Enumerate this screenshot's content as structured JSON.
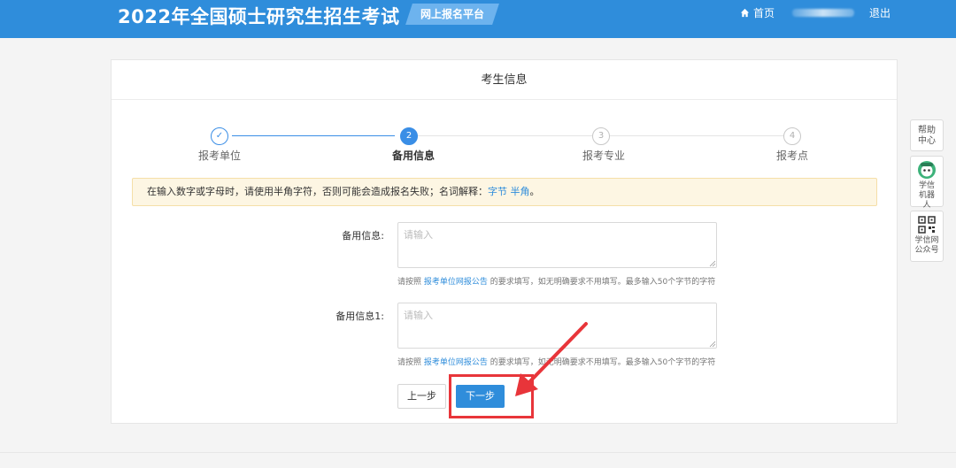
{
  "header": {
    "title": "2022年全国硕士研究生招生考试",
    "platform_badge": "网上报名平台",
    "home_label": "首页",
    "logout_label": "退出"
  },
  "card": {
    "title": "考生信息"
  },
  "steps": [
    {
      "number": "✓",
      "label": "报考单位",
      "state": "done"
    },
    {
      "number": "2",
      "label": "备用信息",
      "state": "active"
    },
    {
      "number": "3",
      "label": "报考专业",
      "state": "todo"
    },
    {
      "number": "4",
      "label": "报考点",
      "state": "todo"
    }
  ],
  "notice": {
    "text": "在输入数字或字母时，请使用半角字符，否则可能会造成报名失败；名词解释：",
    "link_byte": "字节",
    "link_halfwidth": "半角",
    "end": "。"
  },
  "form": {
    "field1": {
      "label": "备用信息:",
      "placeholder": "请输入",
      "value": "",
      "hint_prefix": "请按照",
      "hint_link": "报考单位网报公告",
      "hint_suffix": "的要求填写，如无明确要求不用填写。最多输入50个字节的字符"
    },
    "field2": {
      "label": "备用信息1:",
      "placeholder": "请输入",
      "value": "",
      "hint_prefix": "请按照",
      "hint_link": "报考单位网报公告",
      "hint_suffix": "的要求填写，如无明确要求不用填写。最多输入50个字节的字符"
    }
  },
  "buttons": {
    "prev": "上一步",
    "next": "下一步"
  },
  "side_tools": {
    "help": "帮助中心",
    "robot": "学信机器人",
    "wechat": "学信网公众号"
  },
  "colors": {
    "header_blue": "#2f8ddb",
    "accent_blue": "#3a8ee6",
    "highlight_red": "#e8353a",
    "notice_bg": "#fdf6e3"
  },
  "icons": {
    "home": "home-icon",
    "robot": "robot-avatar-icon",
    "qrcode": "qrcode-icon"
  }
}
